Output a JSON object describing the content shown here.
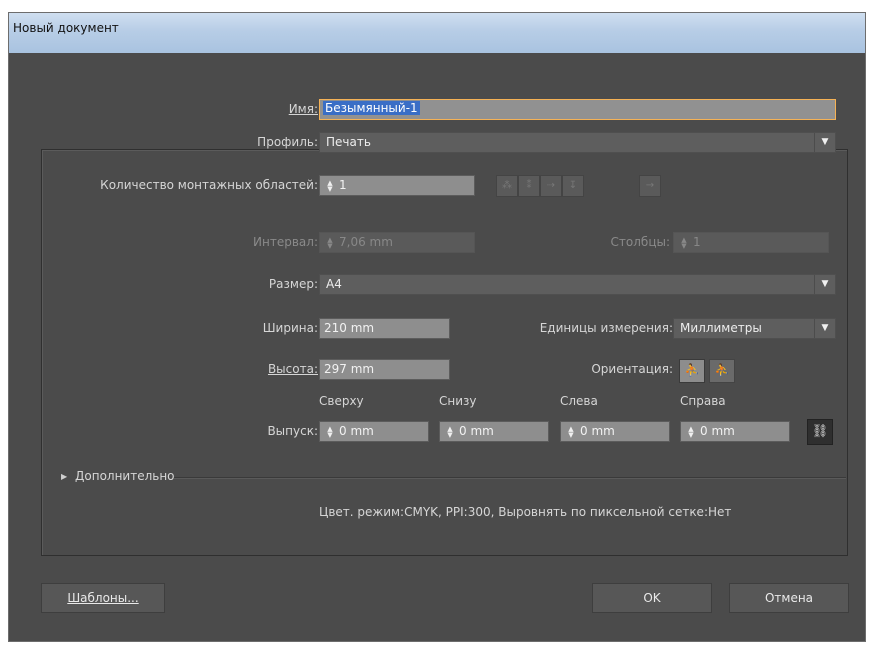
{
  "window": {
    "title": "Новый документ"
  },
  "name": {
    "label": "Имя:",
    "value": "Безымянный-1"
  },
  "profile": {
    "label": "Профиль:",
    "value": "Печать"
  },
  "artboards": {
    "label": "Количество монтажных областей:",
    "value": "1"
  },
  "spacing": {
    "label": "Интервал:",
    "value": "7,06 mm"
  },
  "columns": {
    "label": "Столбцы:",
    "value": "1"
  },
  "size": {
    "label": "Размер:",
    "value": "A4"
  },
  "width": {
    "label": "Ширина:",
    "value": "210 mm"
  },
  "units": {
    "label": "Единицы измерения:",
    "value": "Миллиметры"
  },
  "height": {
    "label": "Высота:",
    "value": "297 mm"
  },
  "orientation": {
    "label": "Ориентация:"
  },
  "bleed": {
    "label": "Выпуск:",
    "top": {
      "label": "Сверху",
      "value": "0 mm"
    },
    "bottom": {
      "label": "Снизу",
      "value": "0 mm"
    },
    "left": {
      "label": "Слева",
      "value": "0 mm"
    },
    "right": {
      "label": "Справа",
      "value": "0 mm"
    }
  },
  "advanced": {
    "label": "Дополнительно"
  },
  "summary": "Цвет. режим:CMYK, PPI:300, Выровнять по пиксельной сетке:Нет",
  "buttons": {
    "templates": "Шаблоны...",
    "ok": "OK",
    "cancel": "Отмена"
  },
  "icons": {
    "arrange_grid_by_row": "grid-by-row-icon",
    "arrange_grid_by_column": "grid-by-column-icon",
    "arrange_by_row": "arrange-by-row-icon",
    "arrange_by_column": "arrange-by-column-icon",
    "layout_direction": "arrow-right-icon",
    "portrait": "portrait-icon",
    "landscape": "landscape-icon",
    "link": "link-icon"
  },
  "colors": {
    "accent_focus": "#f5b256",
    "selection": "#3a6ec6",
    "dialog_bg": "#4b4b4b"
  }
}
